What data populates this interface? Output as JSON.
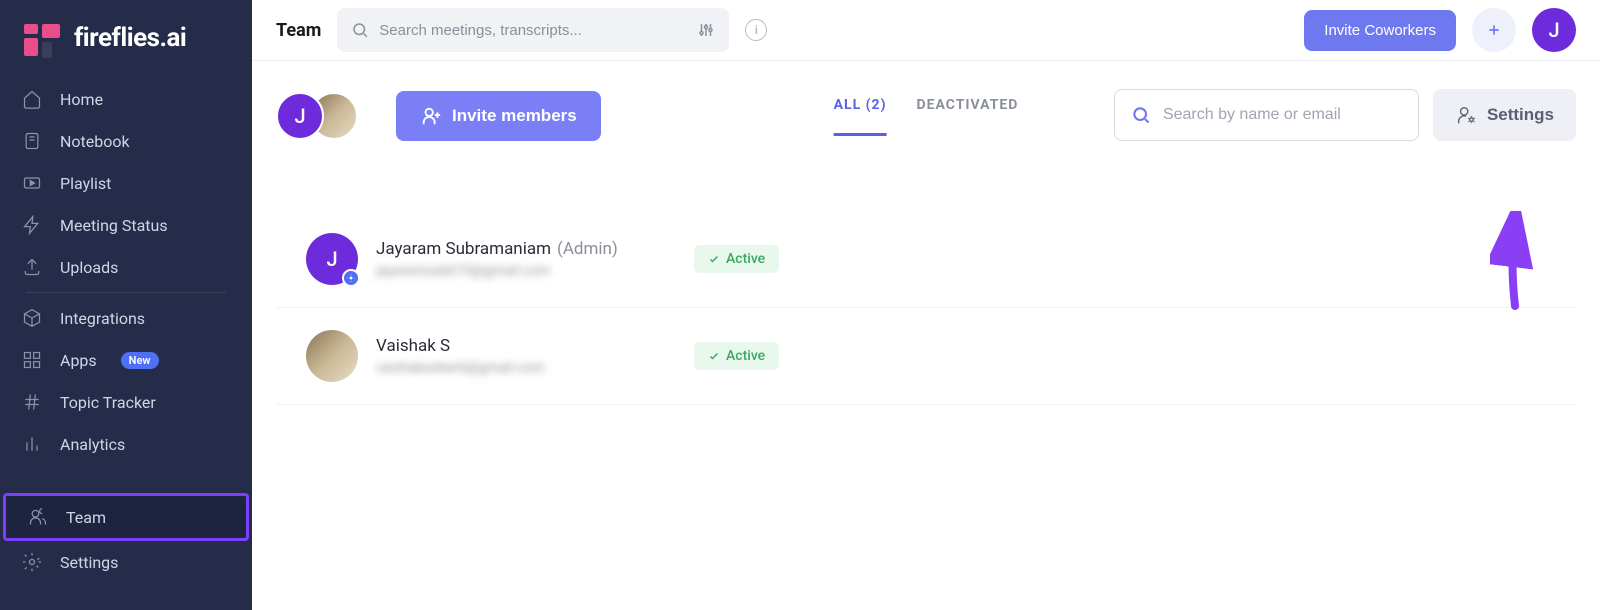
{
  "brand": {
    "name": "fireflies.ai"
  },
  "sidebar": {
    "items": [
      {
        "label": "Home"
      },
      {
        "label": "Notebook"
      },
      {
        "label": "Playlist"
      },
      {
        "label": "Meeting Status"
      },
      {
        "label": "Uploads"
      },
      {
        "label": "Integrations"
      },
      {
        "label": "Apps",
        "badge": "New"
      },
      {
        "label": "Topic Tracker"
      },
      {
        "label": "Analytics"
      },
      {
        "label": "Team"
      },
      {
        "label": "Settings"
      }
    ]
  },
  "header": {
    "title": "Team",
    "search_placeholder": "Search meetings, transcripts...",
    "invite_btn": "Invite Coworkers",
    "avatar_initial": "J"
  },
  "team": {
    "stack_initial": "J",
    "invite_members_btn": "Invite members",
    "tabs": {
      "all": "ALL (2)",
      "deactivated": "DEACTIVATED"
    },
    "search_placeholder": "Search by name or email",
    "settings_btn": "Settings",
    "members": [
      {
        "initial": "J",
        "name": "Jayaram Subramaniam",
        "role": "(Admin)",
        "email": "jayaramsub675@gmail.com",
        "status": "Active",
        "is_admin": true
      },
      {
        "initial": "",
        "name": "Vaishak S",
        "role": "",
        "email": "vaishakankar6@gmail.com",
        "status": "Active",
        "is_admin": false
      }
    ]
  },
  "colors": {
    "accent": "#6f79ef",
    "purple": "#6e2bdb",
    "sidebar_bg": "#252c4a",
    "highlight_border": "#7b3fff",
    "success": "#3ba860"
  }
}
